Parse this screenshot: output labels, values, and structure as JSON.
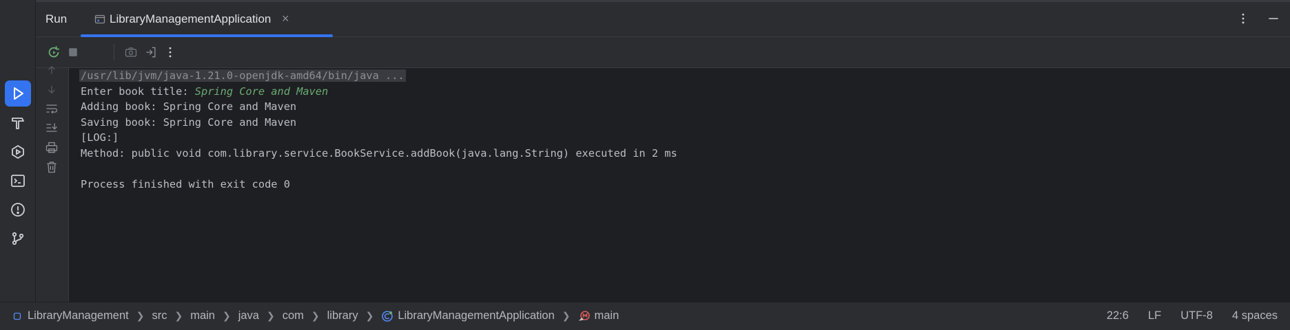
{
  "header": {
    "run_title": "Run",
    "tab_label": "LibraryManagementApplication",
    "close_glyph": "×"
  },
  "console": {
    "lines": [
      "/usr/lib/jvm/java-1.21.0-openjdk-amd64/bin/java ...",
      "Enter book title: ",
      "Adding book: Spring Core and Maven",
      "Saving book: Spring Core and Maven",
      "[LOG:]",
      "Method: public void com.library.service.BookService.addBook(java.lang.String) executed in 2 ms",
      "",
      "Process finished with exit code 0"
    ],
    "user_input": "Spring Core and Maven"
  },
  "breadcrumbs": [
    "LibraryManagement",
    "src",
    "main",
    "java",
    "com",
    "library",
    "LibraryManagementApplication",
    "main"
  ],
  "status": {
    "position": "22:6",
    "line_separator": "LF",
    "encoding": "UTF-8",
    "indent": "4 spaces"
  },
  "colors": {
    "accent": "#3574f0",
    "background": "#1e1f22",
    "panel": "#2b2d30",
    "input_green": "#6aab73"
  },
  "icons": {
    "left_bar": [
      "run-icon",
      "build-hammer-icon",
      "services-icon",
      "terminal-icon",
      "problems-icon",
      "git-icon"
    ],
    "toolbar": [
      "rerun-icon",
      "stop-icon",
      "camera-icon",
      "exit-icon",
      "more-vertical-icon"
    ],
    "gutter": [
      "arrow-up-icon",
      "arrow-down-icon",
      "soft-wrap-icon",
      "scroll-to-end-icon",
      "print-icon",
      "trash-icon"
    ]
  }
}
